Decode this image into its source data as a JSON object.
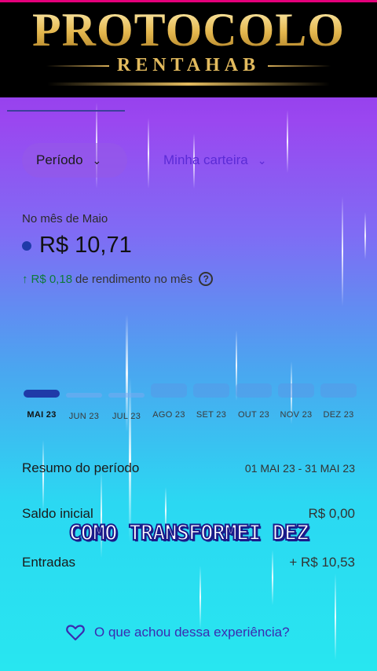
{
  "banner": {
    "title": "PROTOCOLO",
    "subtitle": "RENTAHAB"
  },
  "filters": {
    "period_label": "Período",
    "wallet_label": "Minha carteira"
  },
  "summary_header": {
    "month_label": "No mês de Maio",
    "balance": "R$ 10,71",
    "yield_value": "R$ 0,18",
    "yield_text": "de rendimento no mês",
    "info_glyph": "?"
  },
  "months": [
    {
      "label": "MAI 23",
      "active": true,
      "level": 1.0
    },
    {
      "label": "JUN 23",
      "active": false,
      "level": 0.7
    },
    {
      "label": "JUL 23",
      "active": false,
      "level": 0.7
    },
    {
      "label": "AGO 23",
      "active": false,
      "level": 2.0
    },
    {
      "label": "SET 23",
      "active": false,
      "level": 2.0
    },
    {
      "label": "OUT 23",
      "active": false,
      "level": 2.0
    },
    {
      "label": "NOV 23",
      "active": false,
      "level": 2.0
    },
    {
      "label": "DEZ 23",
      "active": false,
      "level": 2.0
    }
  ],
  "period_summary": {
    "title": "Resumo do período",
    "range": "01 MAI 23 - 31 MAI 23",
    "saldo_label": "Saldo inicial",
    "saldo_value": "R$ 0,00",
    "entradas_label": "Entradas",
    "entradas_value": "+ R$ 10,53"
  },
  "caption": "COMO TRANSFORMEI DEZ",
  "feedback": {
    "label": "O que achou dessa experiência?",
    "icon": "heart-icon"
  },
  "colors": {
    "accent": "#5b2bd6",
    "active_bar": "#1f3aa8",
    "gain": "#0f7a3a"
  }
}
